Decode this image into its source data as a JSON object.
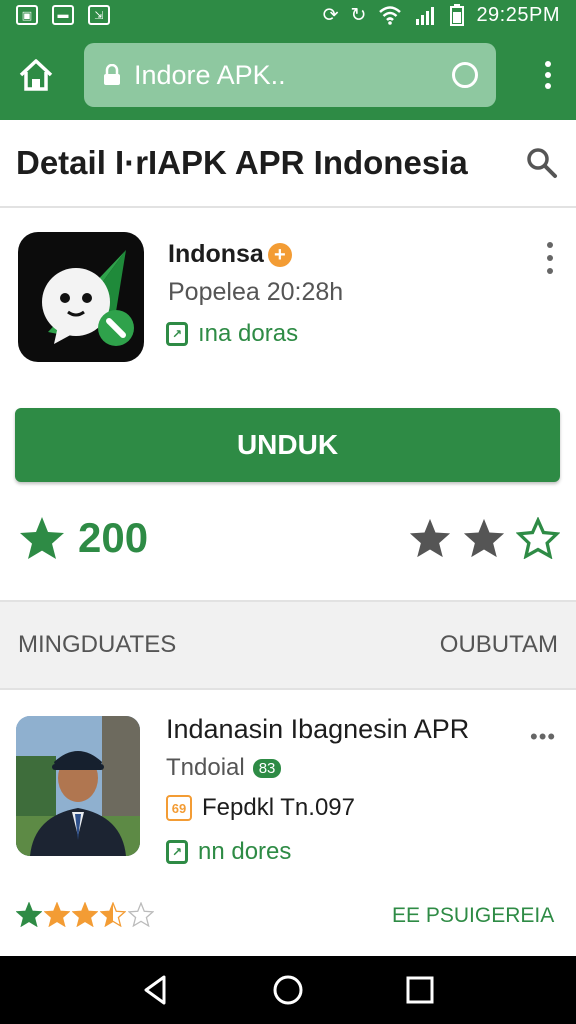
{
  "status_bar": {
    "left_icons": [
      "image-notification-icon",
      "message-notification-icon",
      "download-notification-icon"
    ],
    "right_icons": [
      "sync-icon",
      "rotate-icon",
      "wifi-icon",
      "signal-icon",
      "battery-icon"
    ],
    "time": "29:25PM"
  },
  "browser": {
    "url": "Indore APK.."
  },
  "header": {
    "title": "Detail I·rIAPK APR Indonesia"
  },
  "app": {
    "name": "Indonsa",
    "meta": "Popelea 20:28h",
    "tag": "ına doras",
    "download_label": "UNDUK",
    "rating_count": "200",
    "rate_stars": [
      "filled-dark",
      "filled-dark",
      "outline-green"
    ]
  },
  "section": {
    "label": "MINGDUATES",
    "link": "OUBUTAM"
  },
  "item": {
    "title": "Indanasin Ibagnesin APR",
    "subtitle": "Tndoial",
    "badge": "83",
    "version_badge": "69",
    "version": "Fepdkl Tn.097",
    "tag": "nn dores",
    "rating": 3.5,
    "rating_max": 5,
    "link": "EE PSUIGEREIA",
    "more": "•••"
  },
  "colors": {
    "brand_green": "#2e8b45",
    "accent_orange": "#f39c34"
  }
}
